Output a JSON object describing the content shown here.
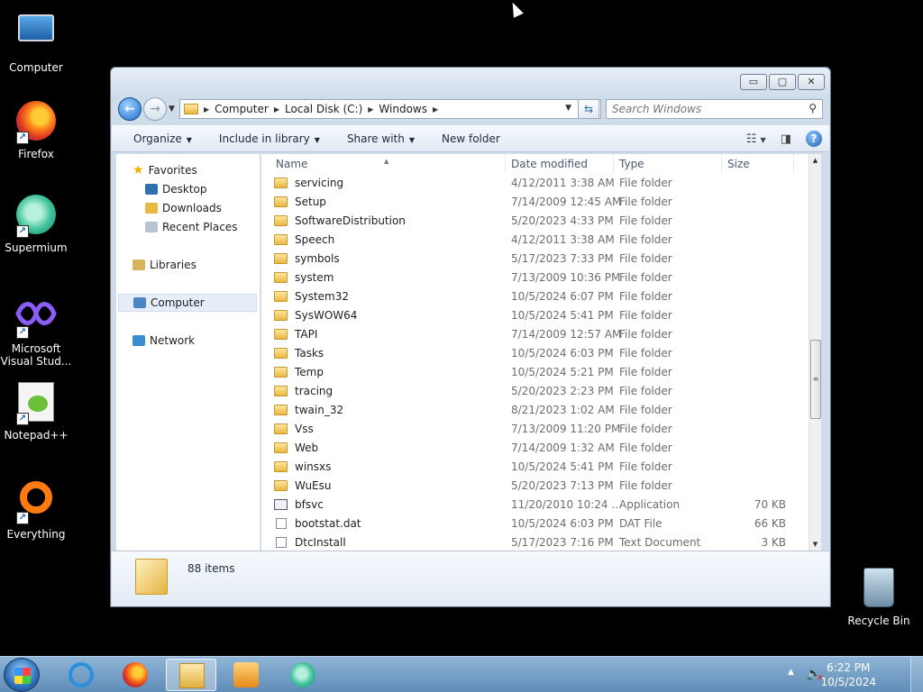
{
  "desktop": {
    "icons": [
      {
        "label": "Computer"
      },
      {
        "label": "Firefox"
      },
      {
        "label": "Supermium"
      },
      {
        "label": "Microsoft Visual Stud..."
      },
      {
        "label": "Notepad++"
      },
      {
        "label": "Everything"
      },
      {
        "label": "Recycle Bin"
      }
    ]
  },
  "window": {
    "controls": {
      "minimize": "▭",
      "maximize": "▢",
      "close": "✕"
    },
    "breadcrumb": [
      "Computer",
      "Local Disk (C:)",
      "Windows"
    ],
    "search": {
      "placeholder": "Search Windows"
    },
    "toolbar": {
      "organize": "Organize",
      "include_in_library": "Include in library",
      "share_with": "Share with",
      "new_folder": "New folder"
    },
    "nav": {
      "favorites": "Favorites",
      "desktop": "Desktop",
      "downloads": "Downloads",
      "recent_places": "Recent Places",
      "libraries": "Libraries",
      "computer": "Computer",
      "network": "Network"
    },
    "columns": {
      "name": "Name",
      "date_modified": "Date modified",
      "type": "Type",
      "size": "Size"
    },
    "files": [
      {
        "name": "servicing",
        "date": "4/12/2011 3:38 AM",
        "type": "File folder",
        "size": "",
        "kind": "folder"
      },
      {
        "name": "Setup",
        "date": "7/14/2009 12:45 AM",
        "type": "File folder",
        "size": "",
        "kind": "folder"
      },
      {
        "name": "SoftwareDistribution",
        "date": "5/20/2023 4:33 PM",
        "type": "File folder",
        "size": "",
        "kind": "folder"
      },
      {
        "name": "Speech",
        "date": "4/12/2011 3:38 AM",
        "type": "File folder",
        "size": "",
        "kind": "folder"
      },
      {
        "name": "symbols",
        "date": "5/17/2023 7:33 PM",
        "type": "File folder",
        "size": "",
        "kind": "folder"
      },
      {
        "name": "system",
        "date": "7/13/2009 10:36 PM",
        "type": "File folder",
        "size": "",
        "kind": "folder"
      },
      {
        "name": "System32",
        "date": "10/5/2024 6:07 PM",
        "type": "File folder",
        "size": "",
        "kind": "folder"
      },
      {
        "name": "SysWOW64",
        "date": "10/5/2024 5:41 PM",
        "type": "File folder",
        "size": "",
        "kind": "folder"
      },
      {
        "name": "TAPI",
        "date": "7/14/2009 12:57 AM",
        "type": "File folder",
        "size": "",
        "kind": "folder"
      },
      {
        "name": "Tasks",
        "date": "10/5/2024 6:03 PM",
        "type": "File folder",
        "size": "",
        "kind": "folder"
      },
      {
        "name": "Temp",
        "date": "10/5/2024 5:21 PM",
        "type": "File folder",
        "size": "",
        "kind": "folder"
      },
      {
        "name": "tracing",
        "date": "5/20/2023 2:23 PM",
        "type": "File folder",
        "size": "",
        "kind": "folder"
      },
      {
        "name": "twain_32",
        "date": "8/21/2023 1:02 AM",
        "type": "File folder",
        "size": "",
        "kind": "folder"
      },
      {
        "name": "Vss",
        "date": "7/13/2009 11:20 PM",
        "type": "File folder",
        "size": "",
        "kind": "folder"
      },
      {
        "name": "Web",
        "date": "7/14/2009 1:32 AM",
        "type": "File folder",
        "size": "",
        "kind": "folder"
      },
      {
        "name": "winsxs",
        "date": "10/5/2024 5:41 PM",
        "type": "File folder",
        "size": "",
        "kind": "folder"
      },
      {
        "name": "WuEsu",
        "date": "5/20/2023 7:13 PM",
        "type": "File folder",
        "size": "",
        "kind": "folder"
      },
      {
        "name": "bfsvc",
        "date": "11/20/2010 10:24 ...",
        "type": "Application",
        "size": "70 KB",
        "kind": "app"
      },
      {
        "name": "bootstat.dat",
        "date": "10/5/2024 6:03 PM",
        "type": "DAT File",
        "size": "66 KB",
        "kind": "doc"
      },
      {
        "name": "DtcInstall",
        "date": "5/17/2023 7:16 PM",
        "type": "Text Document",
        "size": "3 KB",
        "kind": "doc"
      }
    ],
    "status": {
      "items": "88 items"
    }
  },
  "taskbar": {
    "clock_time": "6:22 PM",
    "clock_date": "10/5/2024"
  }
}
